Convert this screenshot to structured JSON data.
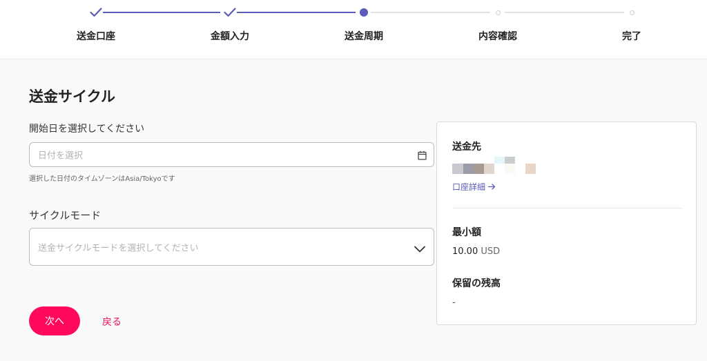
{
  "stepper": {
    "steps": [
      {
        "label": "送金口座",
        "state": "done"
      },
      {
        "label": "金額入力",
        "state": "done"
      },
      {
        "label": "送金周期",
        "state": "active"
      },
      {
        "label": "内容確認",
        "state": "todo"
      },
      {
        "label": "完了",
        "state": "todo"
      }
    ],
    "accent_color": "#5b5bb8"
  },
  "form": {
    "title": "送金サイクル",
    "start_date": {
      "label": "開始日を選択してください",
      "placeholder": "日付を選択",
      "hint": "選択した日付のタイムゾーンはAsia/Tokyoです",
      "icon": "calendar-icon"
    },
    "cycle_mode": {
      "label": "サイクルモード",
      "placeholder": "送金サイクルモードを選択してください",
      "icon": "chevron-down-icon"
    },
    "next_label": "次へ",
    "back_label": "戻る",
    "primary_color": "#ff0a5a"
  },
  "summary": {
    "recipient_title": "送金先",
    "account_details_link": "口座詳細",
    "link_icon": "arrow-right-icon",
    "min_amount_title": "最小額",
    "min_amount_value": "10.00",
    "min_amount_currency": "USD",
    "reserved_balance_title": "保留の残高",
    "reserved_balance_value": "-"
  }
}
